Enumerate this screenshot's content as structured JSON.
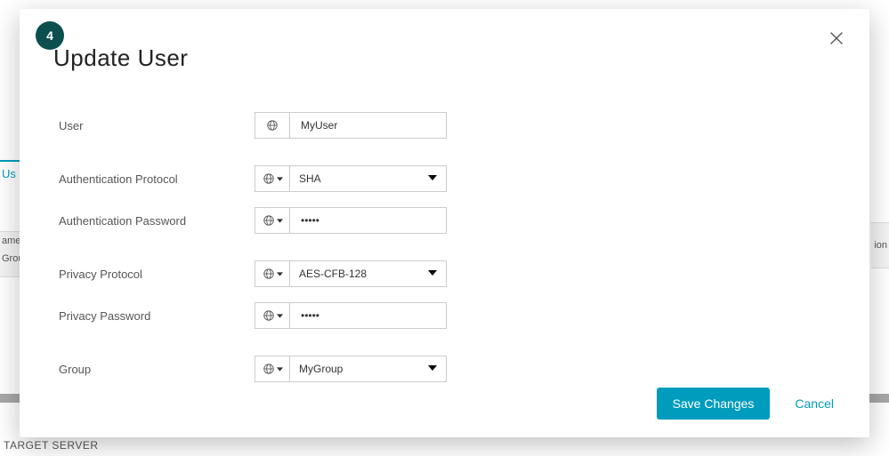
{
  "background": {
    "tab_fragment": "Us",
    "col_left1": "ame",
    "col_left2": "Grou",
    "col_right": "ion",
    "footer": "TARGET SERVER"
  },
  "modal": {
    "step": "4",
    "title": "Update User",
    "fields": {
      "user": {
        "label": "User",
        "value": "MyUser",
        "has_caret": false,
        "type": "text"
      },
      "auth_protocol": {
        "label": "Authentication Protocol",
        "value": "SHA",
        "has_caret": true,
        "type": "select"
      },
      "auth_password": {
        "label": "Authentication Password",
        "value": "•••••",
        "has_caret": true,
        "type": "password"
      },
      "priv_protocol": {
        "label": "Privacy Protocol",
        "value": "AES-CFB-128",
        "has_caret": true,
        "type": "select"
      },
      "priv_password": {
        "label": "Privacy Password",
        "value": "•••••",
        "has_caret": true,
        "type": "password"
      },
      "group": {
        "label": "Group",
        "value": "MyGroup",
        "has_caret": true,
        "type": "select"
      }
    },
    "actions": {
      "save": "Save Changes",
      "cancel": "Cancel"
    }
  }
}
